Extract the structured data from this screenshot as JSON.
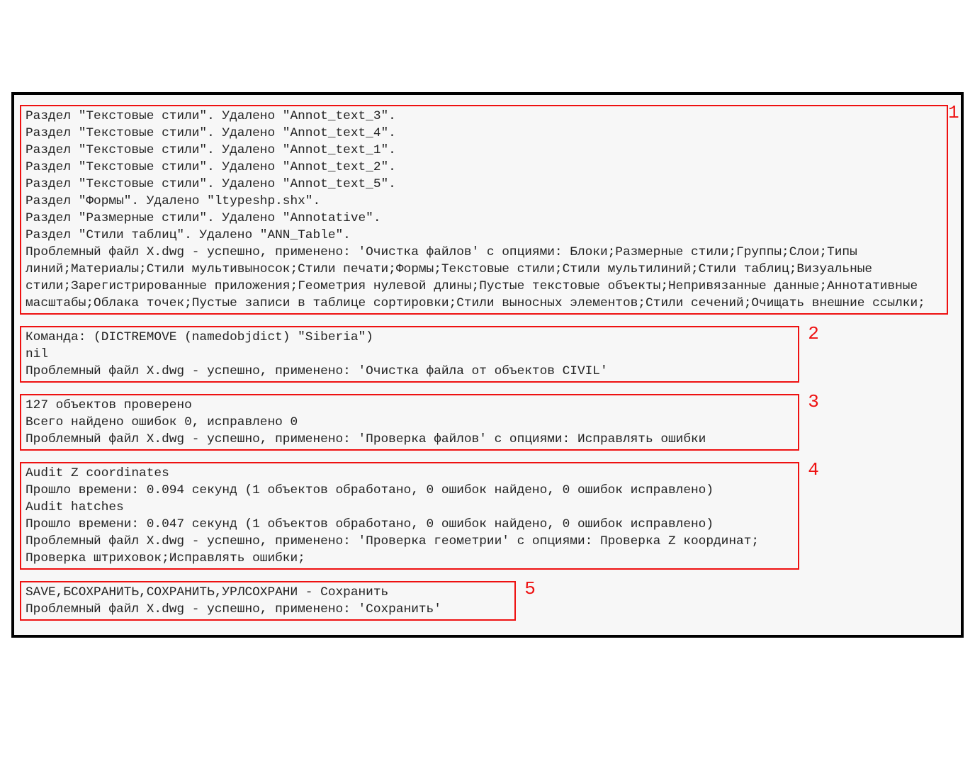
{
  "labels": {
    "s1": "1",
    "s2": "2",
    "s3": "3",
    "s4": "4",
    "s5": "5"
  },
  "sec1": {
    "l0": "Раздел \"Текстовые стили\". Удалено \"Annot_text_3\".",
    "l1": "Раздел \"Текстовые стили\". Удалено \"Annot_text_4\".",
    "l2": "Раздел \"Текстовые стили\". Удалено \"Annot_text_1\".",
    "l3": "Раздел \"Текстовые стили\". Удалено \"Annot_text_2\".",
    "l4": "Раздел \"Текстовые стили\". Удалено \"Annot_text_5\".",
    "l5": "Раздел \"Формы\". Удалено \"ltypeshp.shx\".",
    "l6": "Раздел \"Размерные стили\". Удалено \"Annotative\".",
    "l7": "Раздел \"Стили таблиц\". Удалено \"ANN_Table\".",
    "l8": "Проблемный файл X.dwg - успешно, применено: 'Очистка файлов' с опциями: Блоки;Размерные стили;Группы;Слои;Типы линий;Материалы;Стили мультивыносок;Стили печати;Формы;Текстовые стили;Стили мультилиний;Стили таблиц;Визуальные стили;Зарегистрированные приложения;Геометрия нулевой длины;Пустые текстовые объекты;Непривязанные данные;Аннотативные масштабы;Облака точек;Пустые записи в таблице сортировки;Стили выносных элементов;Стили сечений;Очищать внешние ссылки;"
  },
  "sec2": {
    "l0": "Команда: (DICTREMOVE (namedobjdict) \"Siberia\")",
    "l1": "nil",
    "l2": "Проблемный файл X.dwg - успешно, применено: 'Очистка файла от объектов CIVIL'"
  },
  "sec3": {
    "l0": "127 объектов проверено",
    "l1": "Всего найдено ошибок 0, исправлено 0",
    "l2": "Проблемный файл X.dwg - успешно, применено: 'Проверка файлов' с опциями: Исправлять ошибки"
  },
  "sec4": {
    "l0": "Audit Z coordinates",
    "l1": "Прошло времени: 0.094 секунд (1 объектов обработано, 0 ошибок найдено, 0 ошибок исправлено)",
    "l2": "Audit hatches",
    "l3": "Прошло времени: 0.047 секунд (1 объектов обработано, 0 ошибок найдено, 0 ошибок исправлено)",
    "l4": "Проблемный файл X.dwg - успешно, применено: 'Проверка геометрии' с опциями: Проверка Z координат; Проверка штриховок;Исправлять ошибки;"
  },
  "sec5": {
    "l0": "SAVE,БСОХРАНИТЬ,СОХРАНИТЬ,УРЛСОХРАНИ - Сохранить",
    "l1": "Проблемный файл X.dwg - успешно, применено: 'Сохранить'"
  }
}
